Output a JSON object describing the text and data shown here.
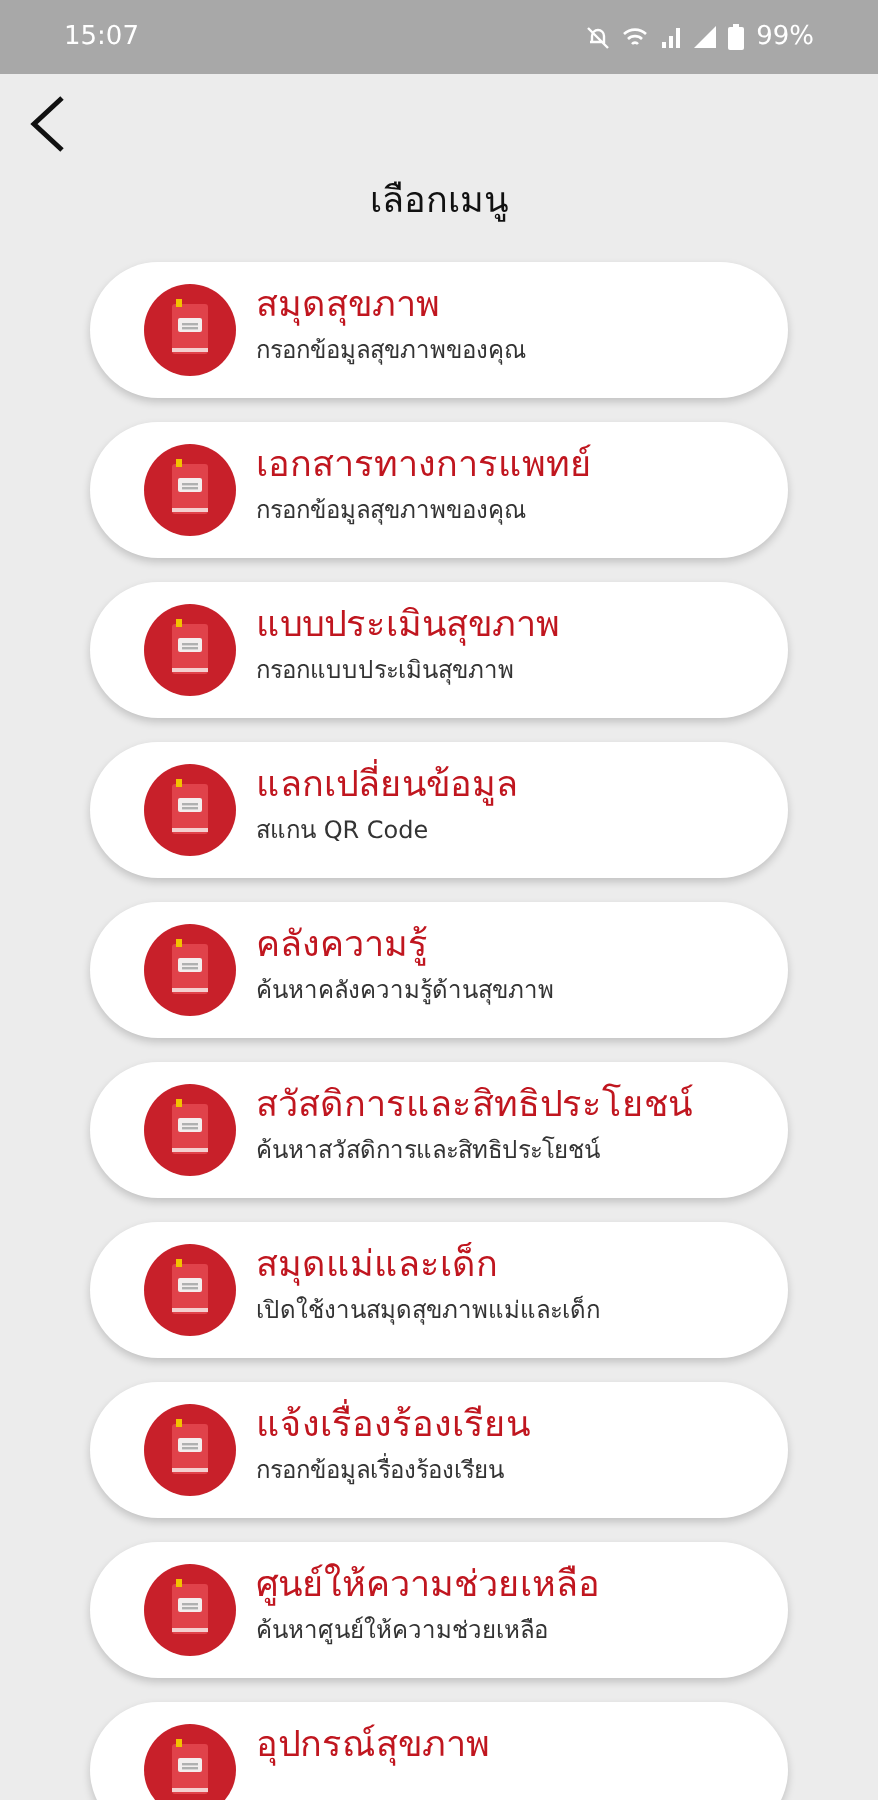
{
  "status_bar": {
    "time": "15:07",
    "battery": "99%"
  },
  "header": {
    "title": "เลือกเมนู"
  },
  "menu": [
    {
      "title": "สมุดสุขภาพ",
      "subtitle": "กรอกข้อมูลสุขภาพของคุณ"
    },
    {
      "title": "เอกสารทางการแพทย์",
      "subtitle": "กรอกข้อมูลสุขภาพของคุณ"
    },
    {
      "title": "แบบประเมินสุขภาพ",
      "subtitle": "กรอกแบบประเมินสุขภาพ"
    },
    {
      "title": "แลกเปลี่ยนข้อมูล",
      "subtitle": "สแกน QR Code"
    },
    {
      "title": "คลังความรู้",
      "subtitle": "ค้นหาคลังความรู้ด้านสุขภาพ"
    },
    {
      "title": "สวัสดิการและสิทธิประโยชน์",
      "subtitle": "ค้นหาสวัสดิการและสิทธิประโยชน์"
    },
    {
      "title": "สมุดแม่และเด็ก",
      "subtitle": "เปิดใช้งานสมุดสุขภาพแม่และเด็ก"
    },
    {
      "title": "แจ้งเรื่องร้องเรียน",
      "subtitle": "กรอกข้อมูลเรื่องร้องเรียน"
    },
    {
      "title": "ศูนย์ให้ความช่วยเหลือ",
      "subtitle": "ค้นหาศูนย์ให้ความช่วยเหลือ"
    },
    {
      "title": "อุปกรณ์สุขภาพ"
    }
  ]
}
